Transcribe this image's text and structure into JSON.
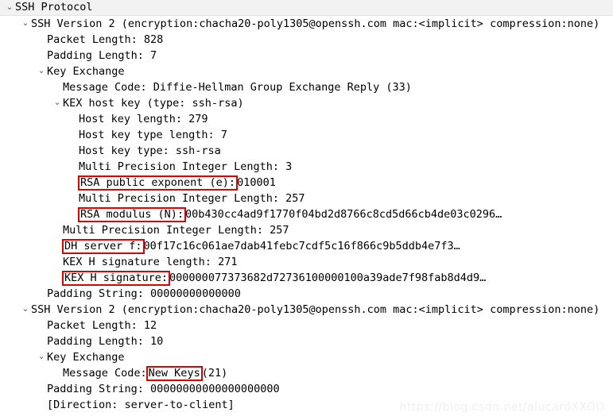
{
  "window": {
    "title": "SSH Protocol",
    "watermark": "https://blog.csdn.net/alucardXXOO"
  },
  "colors": {
    "highlight_box": "#e50000",
    "selected_row": "#f2f2f2",
    "text": "#000000",
    "twisty": "#606060"
  },
  "icons": {
    "expanded": "⌄"
  },
  "tree": [
    {
      "id": "ssh-protocol",
      "depth": 0,
      "twisty": "expanded",
      "text": "SSH Protocol",
      "selected": true
    },
    {
      "id": "ssh-version-2-first",
      "depth": 1,
      "twisty": "expanded",
      "text": "SSH Version 2 (encryption:chacha20-poly1305@openssh.com mac:<implicit> compression:none)"
    },
    {
      "id": "packet-length-828",
      "depth": 2,
      "twisty": "none",
      "text": "Packet Length: 828"
    },
    {
      "id": "padding-length-7",
      "depth": 2,
      "twisty": "none",
      "text": "Padding Length: 7"
    },
    {
      "id": "key-exchange-first",
      "depth": 2,
      "twisty": "expanded",
      "text": "Key Exchange"
    },
    {
      "id": "message-code-dh-gex-reply",
      "depth": 3,
      "twisty": "none",
      "text": "Message Code: Diffie-Hellman Group Exchange Reply (33)"
    },
    {
      "id": "kex-host-key",
      "depth": 3,
      "twisty": "expanded",
      "text": "KEX host key (type: ssh-rsa)"
    },
    {
      "id": "host-key-length",
      "depth": 4,
      "twisty": "none",
      "text": "Host key length: 279"
    },
    {
      "id": "host-key-type-length",
      "depth": 4,
      "twisty": "none",
      "text": "Host key type length: 7"
    },
    {
      "id": "host-key-type",
      "depth": 4,
      "twisty": "none",
      "text": "Host key type: ssh-rsa"
    },
    {
      "id": "mpi-length-3",
      "depth": 4,
      "twisty": "none",
      "text": "Multi Precision Integer Length: 3"
    },
    {
      "id": "rsa-public-exponent",
      "depth": 4,
      "twisty": "none",
      "highlighted_label": "RSA public exponent (e):",
      "value": " 010001"
    },
    {
      "id": "mpi-length-257-a",
      "depth": 4,
      "twisty": "none",
      "text": "Multi Precision Integer Length: 257"
    },
    {
      "id": "rsa-modulus",
      "depth": 4,
      "twisty": "none",
      "highlighted_label": "RSA modulus (N):",
      "value": " 00b430cc4ad9f1770f04bd2d8766c8cd5d66cb4de03c0296…"
    },
    {
      "id": "mpi-length-257-b",
      "depth": 3,
      "twisty": "none",
      "text": "Multi Precision Integer Length: 257"
    },
    {
      "id": "dh-server-f",
      "depth": 3,
      "twisty": "none",
      "highlighted_label": "DH server f:",
      "value": " 00f17c16c061ae7dab41febc7cdf5c16f866c9b5ddb4e7f3…"
    },
    {
      "id": "kex-h-signature-length",
      "depth": 3,
      "twisty": "none",
      "text": "KEX H signature length: 271"
    },
    {
      "id": "kex-h-signature",
      "depth": 3,
      "twisty": "none",
      "highlighted_label": "KEX H signature:",
      "value": " 000000077373682d72736100000100a39ade7f98fab8d4d9…"
    },
    {
      "id": "padding-string-first",
      "depth": 2,
      "twisty": "none",
      "text": "Padding String: 00000000000000"
    },
    {
      "id": "ssh-version-2-second",
      "depth": 1,
      "twisty": "expanded",
      "text": "SSH Version 2 (encryption:chacha20-poly1305@openssh.com mac:<implicit> compression:none)"
    },
    {
      "id": "packet-length-12",
      "depth": 2,
      "twisty": "none",
      "text": "Packet Length: 12"
    },
    {
      "id": "padding-length-10",
      "depth": 2,
      "twisty": "none",
      "text": "Padding Length: 10"
    },
    {
      "id": "key-exchange-second",
      "depth": 2,
      "twisty": "expanded",
      "text": "Key Exchange"
    },
    {
      "id": "message-code-new-keys",
      "depth": 3,
      "twisty": "none",
      "prefix": "Message Code: ",
      "highlighted_label": "New Keys",
      "value": " (21)"
    },
    {
      "id": "padding-string-second",
      "depth": 2,
      "twisty": "none",
      "text": "Padding String: 00000000000000000000"
    },
    {
      "id": "direction",
      "depth": 2,
      "twisty": "none",
      "text": "[Direction: server-to-client]"
    }
  ]
}
